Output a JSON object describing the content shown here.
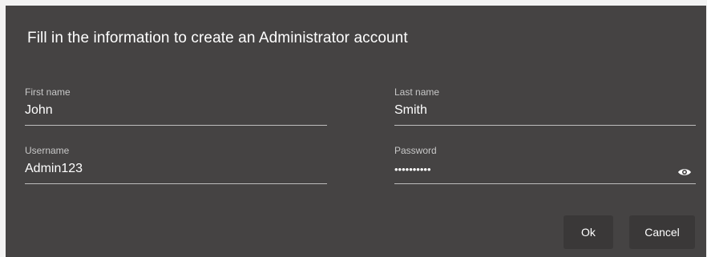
{
  "dialog": {
    "title": "Fill in the information to create an Administrator account"
  },
  "fields": {
    "first_name": {
      "label": "First name",
      "value": "John"
    },
    "last_name": {
      "label": "Last name",
      "value": "Smith"
    },
    "username": {
      "label": "Username",
      "value": "Admin123"
    },
    "password": {
      "label": "Password",
      "value": "••••••••••",
      "masked": true,
      "toggle_icon": "eye-icon"
    }
  },
  "buttons": {
    "ok_label": "Ok",
    "cancel_label": "Cancel"
  },
  "colors": {
    "dialog_background": "#454343",
    "text": "#ffffff",
    "label": "#c8c8c8",
    "underline": "#bdbdbd",
    "button_background": "#3a3838"
  }
}
